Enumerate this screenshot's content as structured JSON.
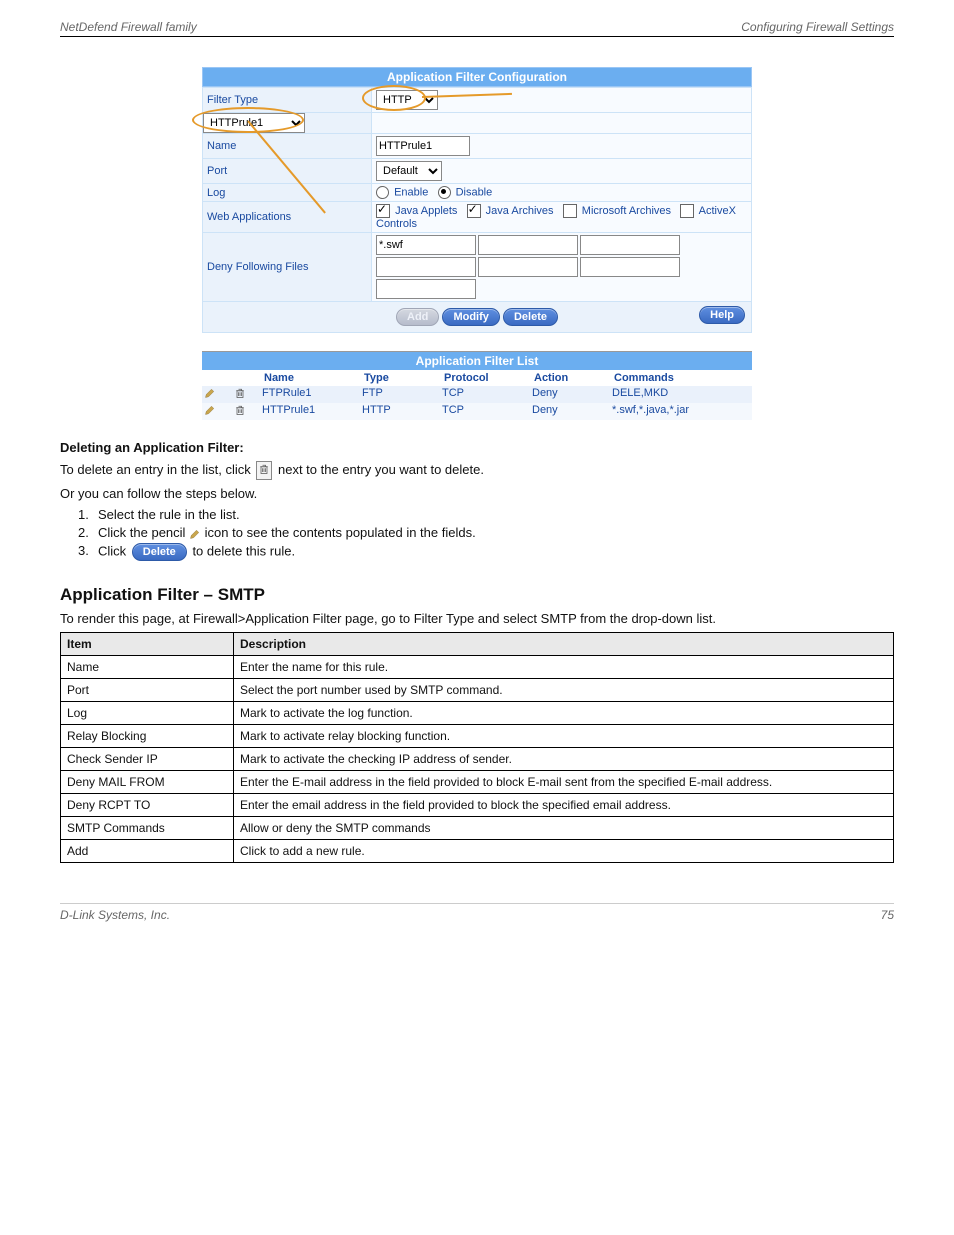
{
  "header": {
    "left": "NetDefend Firewall family",
    "right": "Configuring Firewall Settings"
  },
  "config": {
    "title": "Application Filter Configuration",
    "rows": {
      "filter_type_label": "Filter Type",
      "filter_type_value": "HTTP",
      "selector_value": "HTTPrule1",
      "name_label": "Name",
      "name_value": "HTTPrule1",
      "port_label": "Port",
      "port_value": "Default",
      "log_label": "Log",
      "log_enable": "Enable",
      "log_disable": "Disable",
      "webapps_label": "Web Applications",
      "webapps_ja": "Java Applets",
      "webapps_jar": "Java Archives",
      "webapps_ms": "Microsoft Archives",
      "webapps_ax": "ActiveX Controls",
      "deny_label": "Deny Following Files",
      "deny_value": "*.swf"
    },
    "buttons": {
      "add": "Add",
      "modify": "Modify",
      "delete": "Delete",
      "help": "Help"
    }
  },
  "list": {
    "title": "Application Filter List",
    "cols": [
      "",
      "",
      "Name",
      "Type",
      "Protocol",
      "Action",
      "Commands"
    ],
    "rows": [
      {
        "name": "FTPRule1",
        "type": "FTP",
        "protocol": "TCP",
        "action": "Deny",
        "commands": "DELE,MKD"
      },
      {
        "name": "HTTPrule1",
        "type": "HTTP",
        "protocol": "TCP",
        "action": "Deny",
        "commands": "*.swf,*.java,*.jar"
      }
    ]
  },
  "body": {
    "h_del": "Deleting an Application Filter:",
    "del_1a": "To delete an entry in the list, click ",
    "del_1b": " next to the entry you want to delete.",
    "del_2": "Or you can follow the steps below.",
    "del_s1": "Select the rule in the list.",
    "del_s2a": "Click the pencil ",
    "del_s2b": " icon to see the contents populated in the fields.",
    "del_s3a": "Click ",
    "del_s3b": " to delete this rule.",
    "h_h3": "Application Filter – SMTP",
    "tbl_intro": "To render this page, at Firewall>Application Filter page, go to Filter Type and select SMTP from the drop-down list."
  },
  "flt": {
    "head_item": "Item",
    "head_desc": "Description",
    "rows": [
      {
        "item": "Name",
        "desc": "Enter the name for this rule."
      },
      {
        "item": "Port",
        "desc": "Select the port number used by SMTP command."
      },
      {
        "item": "Log",
        "desc": "Mark to activate the log function."
      },
      {
        "item": "Relay Blocking",
        "desc": "Mark to activate relay blocking function."
      },
      {
        "item": "Check Sender IP",
        "desc": "Mark to activate the checking IP address of sender."
      },
      {
        "item": "Deny MAIL FROM",
        "desc": "Enter the E-mail address in the field provided to block E-mail sent from the specified E-mail address."
      },
      {
        "item": "Deny RCPT TO",
        "desc": "Enter the email address in the field provided to block the specified email address."
      },
      {
        "item": "SMTP Commands",
        "desc": "Allow or deny the SMTP commands"
      },
      {
        "item": "Add",
        "desc": "Click to add a new rule."
      }
    ]
  },
  "footer": {
    "left": "D-Link Systems, Inc.",
    "right": "75"
  }
}
